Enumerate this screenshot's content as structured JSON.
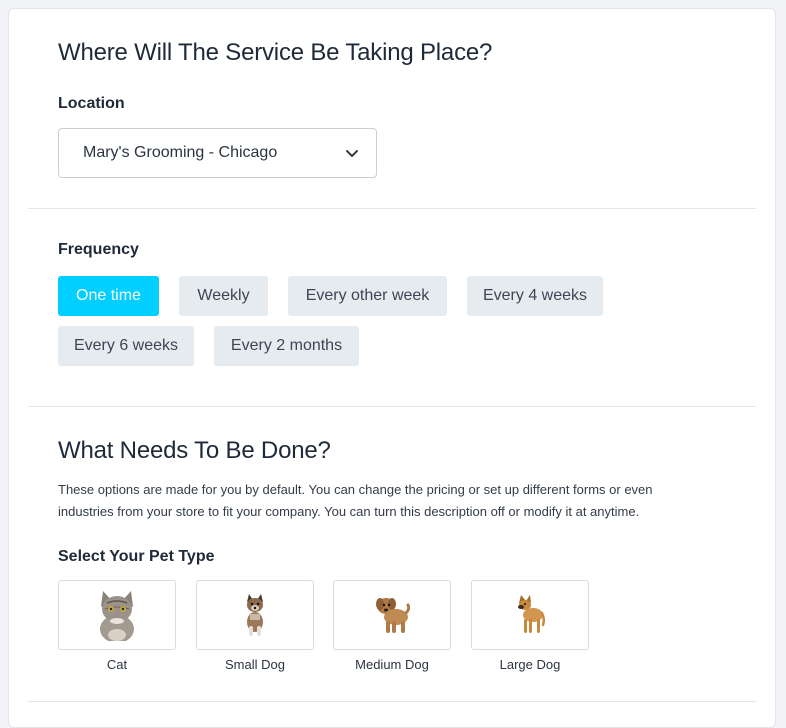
{
  "location_section": {
    "title": "Where Will The Service Be Taking Place?",
    "label": "Location",
    "selected": "Mary's Grooming - Chicago"
  },
  "frequency_section": {
    "label": "Frequency",
    "options": [
      "One time",
      "Weekly",
      "Every other week",
      "Every 4 weeks",
      "Every 6 weeks",
      "Every 2 months"
    ],
    "selected": "One time"
  },
  "service_section": {
    "title": "What Needs To Be Done?",
    "description_line1": "These options are made for you by default. You can change the pricing or set up different forms or even",
    "description_line2": "industries from your store to fit your company. You can turn this description off or modify it at anytime.",
    "pet_label": "Select Your Pet Type",
    "pets": [
      {
        "label": "Cat",
        "icon": "cat-icon"
      },
      {
        "label": "Small Dog",
        "icon": "small-dog-icon"
      },
      {
        "label": "Medium Dog",
        "icon": "medium-dog-icon"
      },
      {
        "label": "Large Dog",
        "icon": "large-dog-icon"
      }
    ]
  },
  "colors": {
    "accent": "#00cfff",
    "button_bg": "#e6ebf0",
    "text": "#1e2a3a"
  }
}
